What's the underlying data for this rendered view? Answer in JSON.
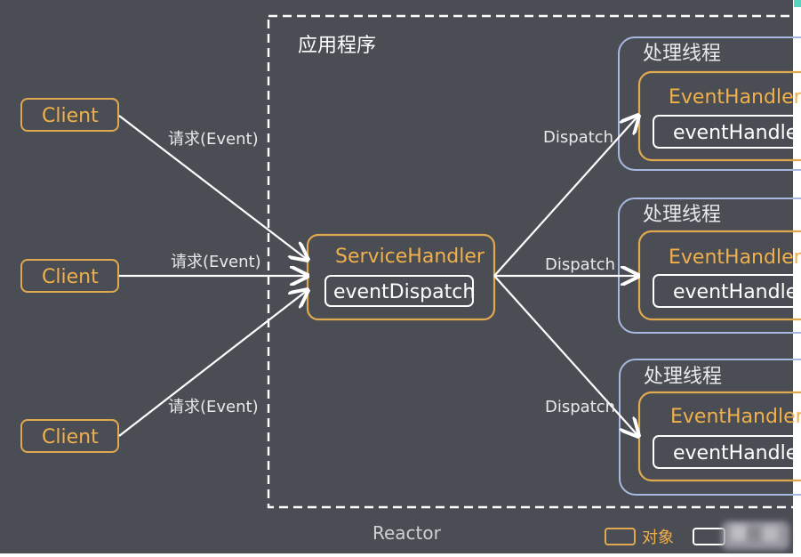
{
  "diagram": {
    "app_region_title": "应用程序",
    "reactor_label": "Reactor",
    "clients": [
      {
        "label": "Client"
      },
      {
        "label": "Client"
      },
      {
        "label": "Client"
      }
    ],
    "request_labels": [
      "请求(Event)",
      "请求(Event)",
      "请求(Event)"
    ],
    "service_handler": {
      "title": "ServiceHandler",
      "method": "eventDispatch"
    },
    "dispatch_labels": [
      "Dispatch",
      "Dispatch",
      "Dispatch"
    ],
    "threads": [
      {
        "title": "处理线程",
        "handler": "EventHandler",
        "method": "eventHandle"
      },
      {
        "title": "处理线程",
        "handler": "EventHandler",
        "method": "eventHandle"
      },
      {
        "title": "处理线程",
        "handler": "EventHandler",
        "method": "eventHandle"
      }
    ],
    "legend": {
      "object_label": "对象"
    }
  },
  "colors": {
    "background": "#4b4d55",
    "object_border": "#e0a94f",
    "thread_border": "#a9b8e0",
    "line": "#ffffff",
    "orange_text": "#f0b04a"
  }
}
